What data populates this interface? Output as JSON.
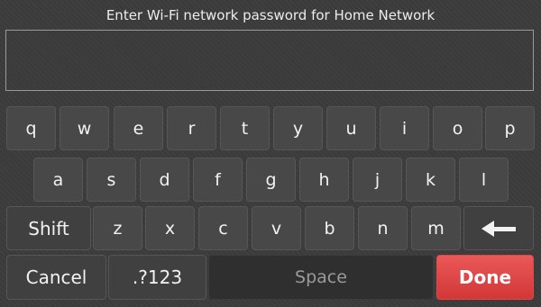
{
  "prompt": "Enter Wi-Fi network password for Home Network",
  "password": {
    "value": "",
    "placeholder": ""
  },
  "keyboard": {
    "row1": [
      "q",
      "w",
      "e",
      "r",
      "t",
      "y",
      "u",
      "i",
      "o",
      "p"
    ],
    "row2": [
      "a",
      "s",
      "d",
      "f",
      "g",
      "h",
      "j",
      "k",
      "l"
    ],
    "row3": {
      "shift": "Shift",
      "letters": [
        "z",
        "x",
        "c",
        "v",
        "b",
        "n",
        "m"
      ],
      "backspace_icon": "left-arrow-icon"
    },
    "row4": {
      "cancel": "Cancel",
      "numbers": ".?123",
      "space": "Space",
      "done": "Done"
    }
  },
  "colors": {
    "done": "#e04848",
    "key": "#484848",
    "background": "#3b3b3b"
  }
}
